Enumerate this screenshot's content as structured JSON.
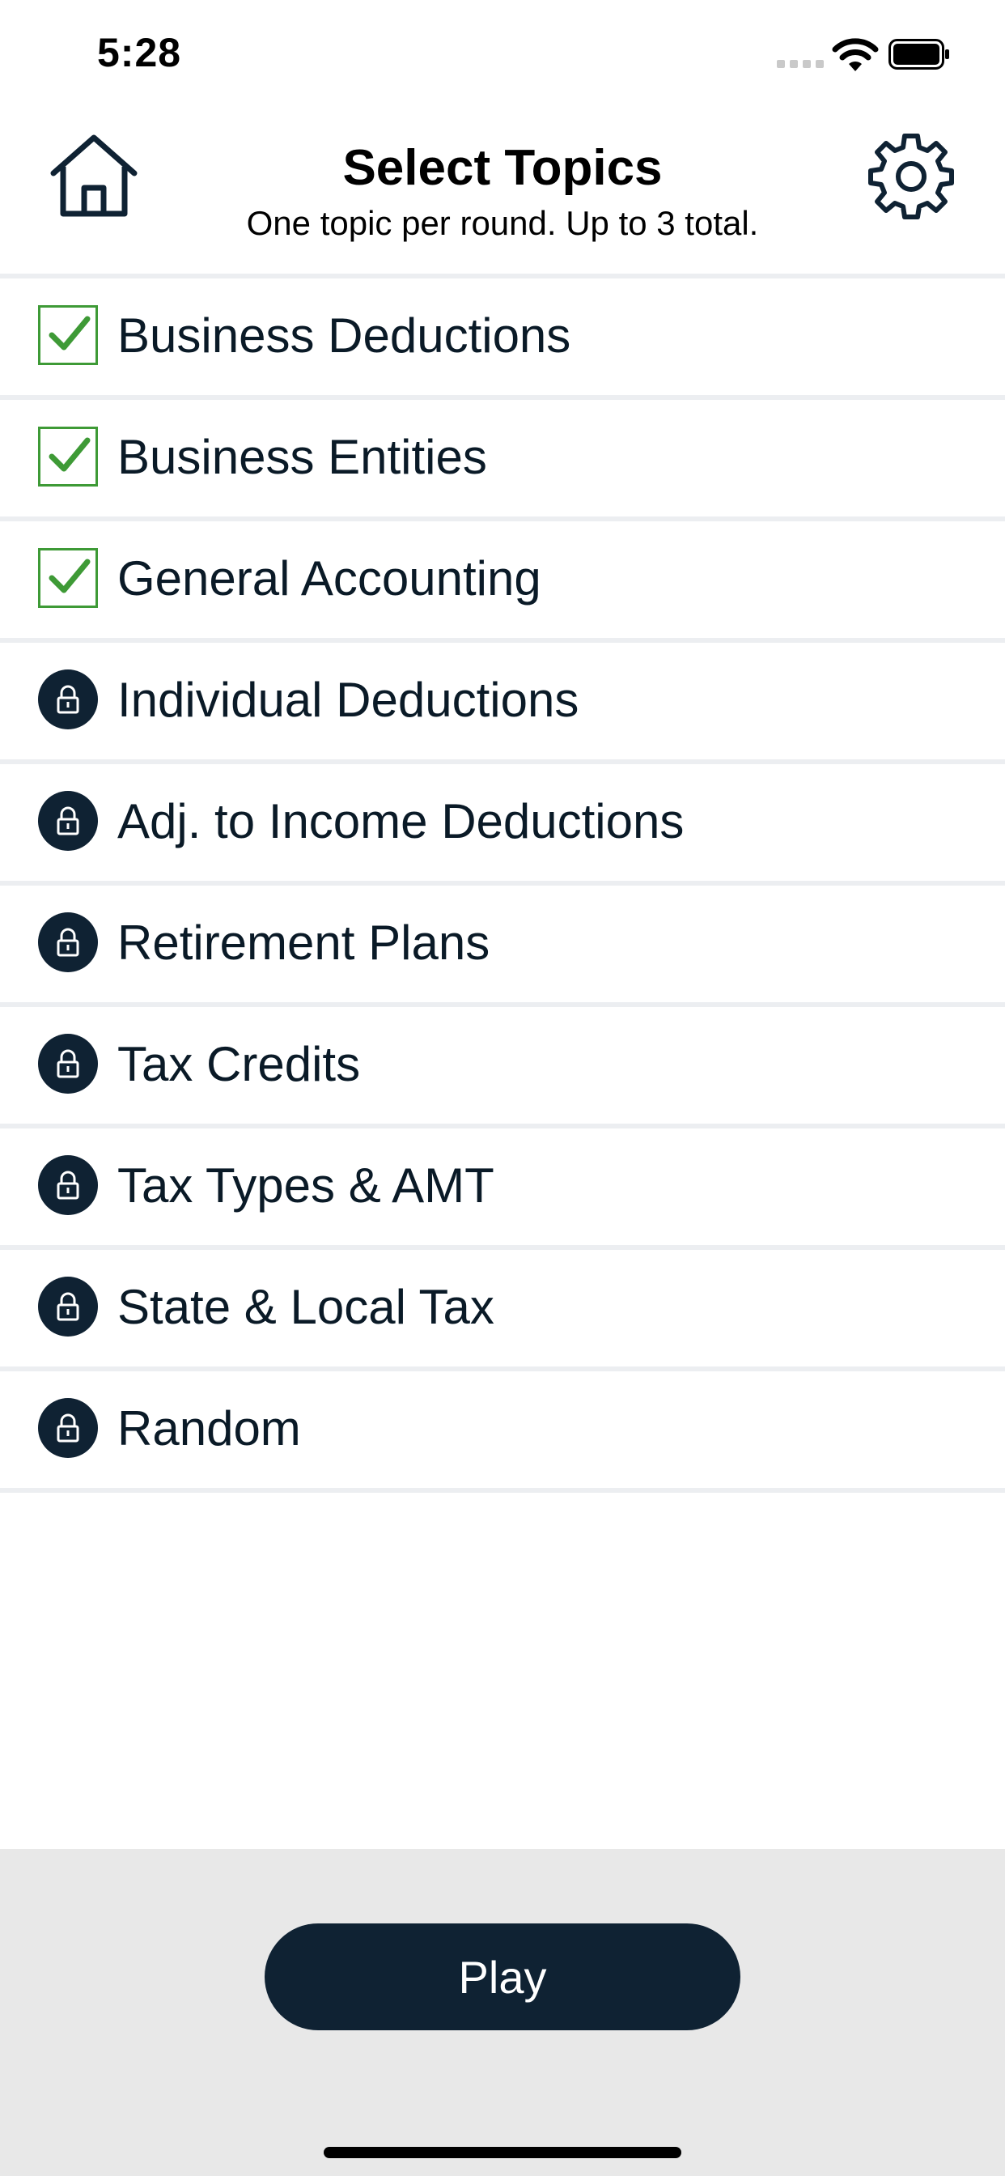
{
  "status_bar": {
    "time": "5:28"
  },
  "header": {
    "title": "Select Topics",
    "subtitle": "One topic per round. Up to 3 total.",
    "home_icon": "home-icon",
    "settings_icon": "gear-icon"
  },
  "topics": [
    {
      "label": "Business Deductions",
      "state": "checked"
    },
    {
      "label": "Business Entities",
      "state": "checked"
    },
    {
      "label": "General Accounting",
      "state": "checked"
    },
    {
      "label": "Individual Deductions",
      "state": "locked"
    },
    {
      "label": "Adj. to Income Deductions",
      "state": "locked"
    },
    {
      "label": "Retirement Plans",
      "state": "locked"
    },
    {
      "label": "Tax Credits",
      "state": "locked"
    },
    {
      "label": "Tax Types & AMT",
      "state": "locked"
    },
    {
      "label": "State & Local Tax",
      "state": "locked"
    },
    {
      "label": "Random",
      "state": "locked"
    }
  ],
  "footer": {
    "play_label": "Play"
  },
  "colors": {
    "navy": "#0f2233",
    "check_green": "#3e9a36",
    "divider": "#eceef1",
    "footer_bg": "#e8e8e8"
  }
}
